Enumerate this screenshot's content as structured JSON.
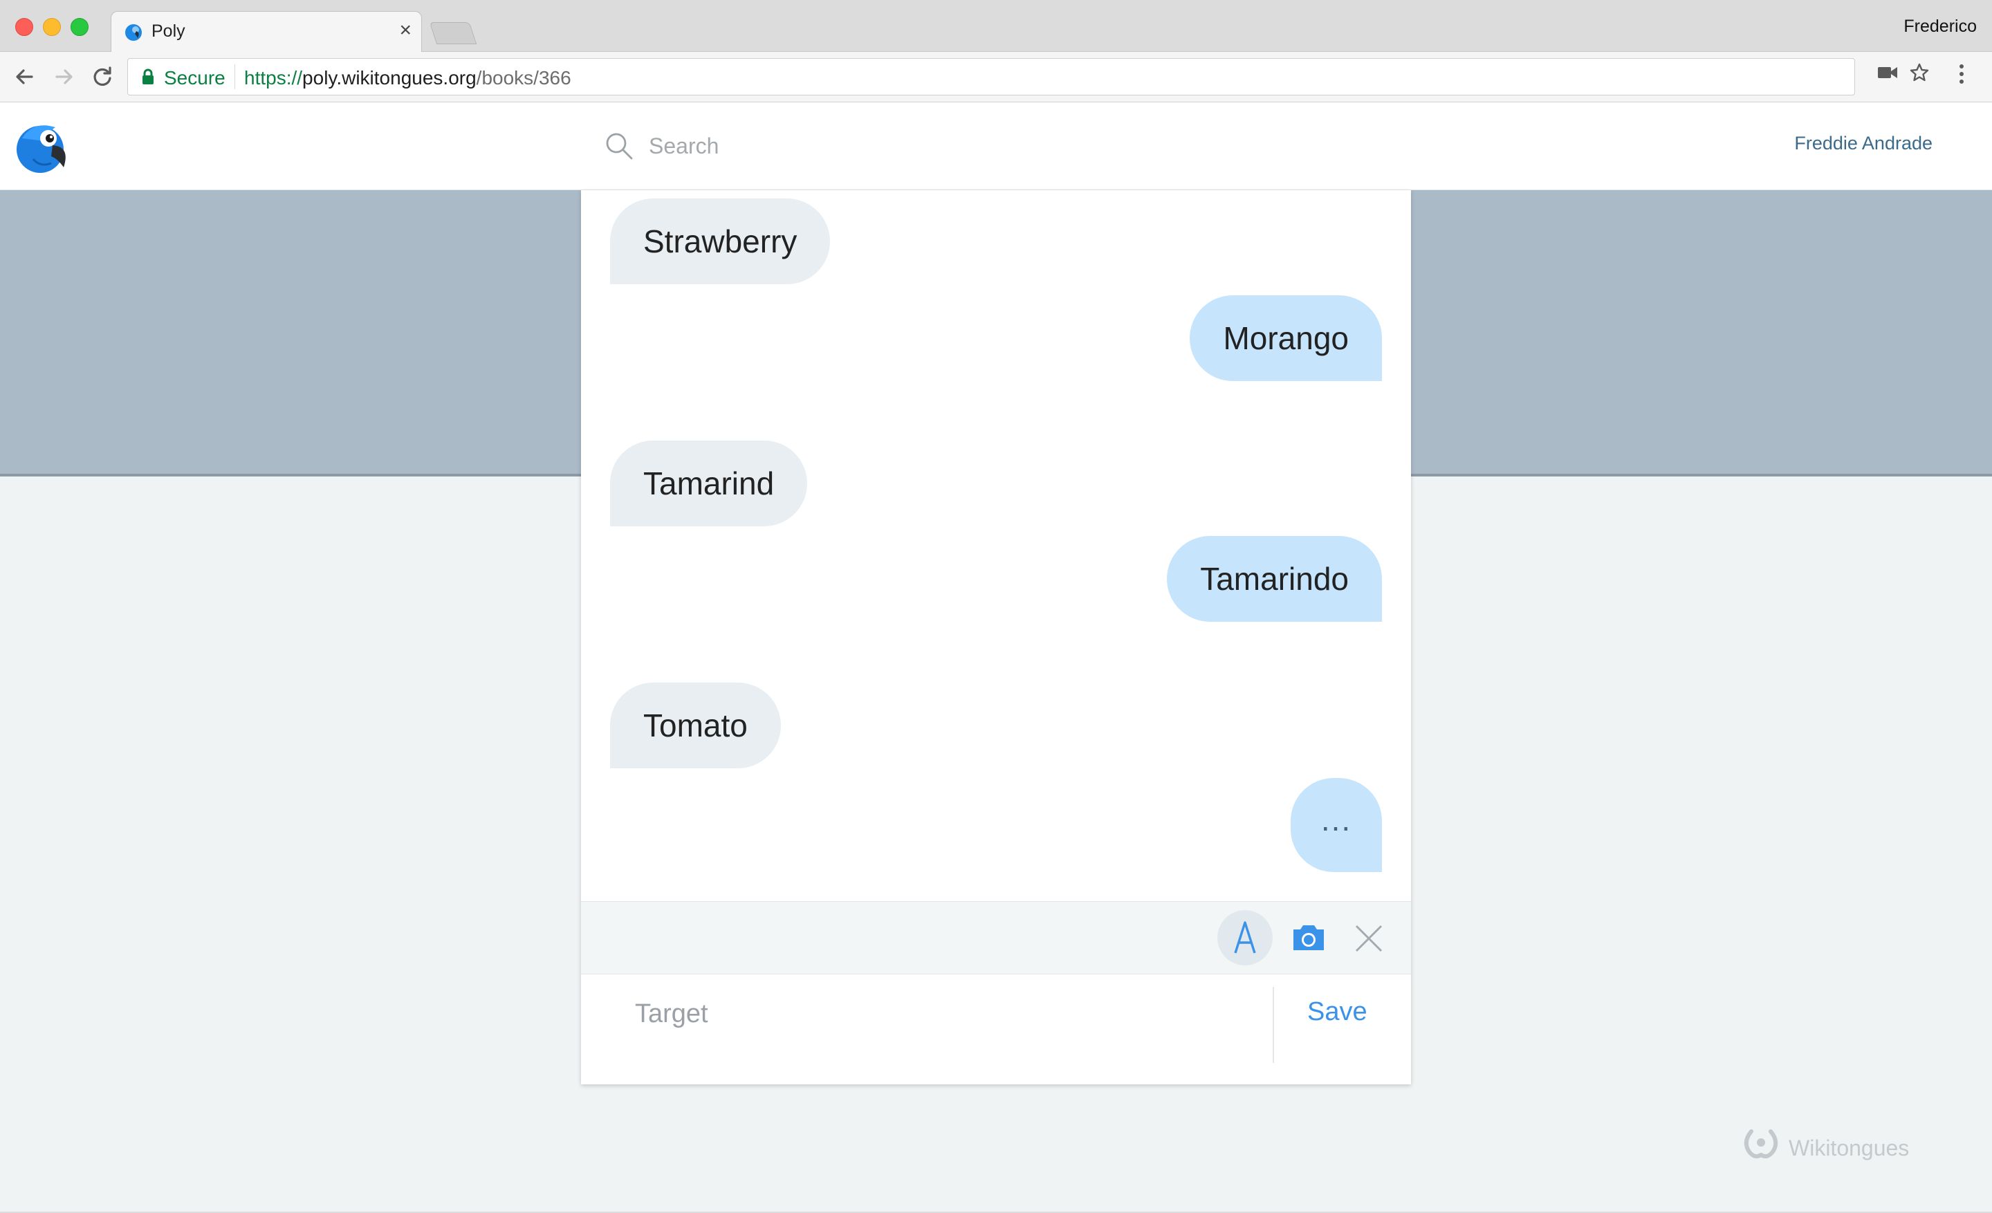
{
  "browser": {
    "tab_title": "Poly",
    "tab_close": "×",
    "profile_name": "Frederico",
    "secure_label": "Secure",
    "url_scheme": "https://",
    "url_host": "poly.wikitongues.org",
    "url_path": "/books/366"
  },
  "header": {
    "search_placeholder": "Search",
    "user_name": "Freddie Andrade"
  },
  "conversation": {
    "messages": [
      {
        "role": "source",
        "text": "Strawberry"
      },
      {
        "role": "target",
        "text": "Morango"
      },
      {
        "role": "source",
        "text": "Tamarind"
      },
      {
        "role": "target",
        "text": "Tamarindo"
      },
      {
        "role": "source",
        "text": "Tomato"
      },
      {
        "role": "target-pending",
        "text": "..."
      }
    ]
  },
  "composer": {
    "target_placeholder": "Target",
    "save_label": "Save"
  },
  "footer": {
    "brand": "Wikitongues"
  },
  "colors": {
    "accent_blue": "#3a93e8",
    "source_bubble": "#e8eef2",
    "target_bubble": "#c6e5fc",
    "banner": "#abbac7",
    "page_background": "#f0f3f4",
    "secure_green": "#0b8043"
  },
  "icons": [
    "parrot-logo-icon",
    "search-icon",
    "text-mode-icon",
    "camera-icon",
    "close-icon",
    "lock-icon",
    "back-icon",
    "forward-icon",
    "reload-icon",
    "video-camera-icon",
    "star-icon",
    "menu-icon",
    "wikitongues-logo-icon"
  ]
}
